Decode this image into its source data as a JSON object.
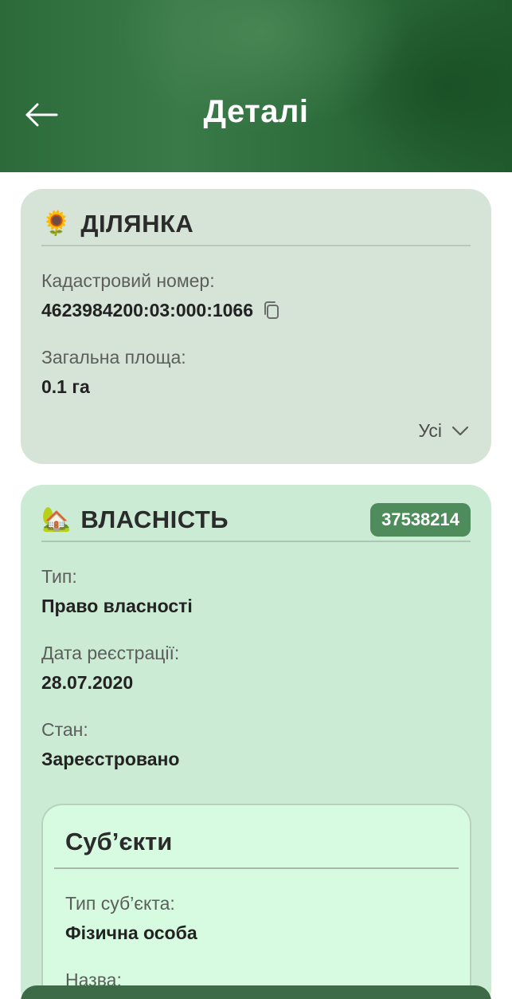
{
  "header": {
    "title": "Деталі",
    "back_icon": "arrow-left-icon"
  },
  "land": {
    "emoji": "🌻",
    "title": "ДІЛЯНКА",
    "fields": [
      {
        "label": "Кадастровий номер:",
        "value": "4623984200:03:000:1066"
      },
      {
        "label": "Загальна площа:",
        "value": "0.1 га"
      }
    ],
    "copy_icon": "copy-icon",
    "expand_label": "Усі",
    "expand_icon": "chevron-down-icon"
  },
  "property": {
    "emoji": "🏡",
    "title": "ВЛАСНІСТЬ",
    "badge": "37538214",
    "fields": [
      {
        "label": "Тип:",
        "value": "Право власності"
      },
      {
        "label": "Дата реєстрації:",
        "value": "28.07.2020"
      },
      {
        "label": "Стан:",
        "value": "Зареєстровано"
      }
    ],
    "subjects": {
      "title": "Суб’єкти",
      "fields": [
        {
          "label": "Тип суб’єкта:",
          "value": "Фізична особа"
        },
        {
          "label": "Назва:"
        }
      ]
    }
  },
  "colors": {
    "header_dark": "#1f5a2c",
    "header_light": "#3a7a48",
    "land_card": "#d6e4d8",
    "property_card": "#ccebd4",
    "subjects_card": "#d6fbe0",
    "badge": "#4e8c5c"
  }
}
